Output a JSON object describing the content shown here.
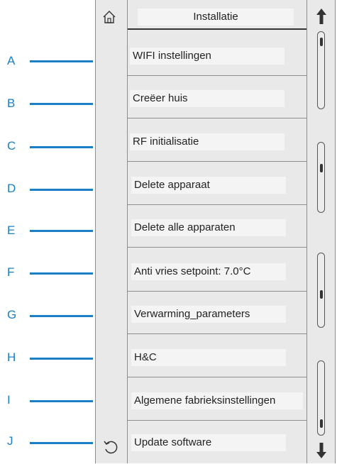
{
  "header": {
    "title": "Installatie"
  },
  "callouts": [
    "A",
    "B",
    "C",
    "D",
    "E",
    "F",
    "G",
    "H",
    "I",
    "J"
  ],
  "menu": {
    "items": [
      {
        "label": "WIFI instellingen"
      },
      {
        "label": "Creëer huis"
      },
      {
        "label": "RF initialisatie"
      },
      {
        "label": "Delete apparaat"
      },
      {
        "label": "Delete alle apparaten"
      },
      {
        "label": "Anti vries setpoint: 7.0°C"
      },
      {
        "label": "Verwarming_parameters"
      },
      {
        "label": "H&C"
      },
      {
        "label": "Algemene fabrieksinstellingen"
      },
      {
        "label": "Update software"
      }
    ]
  },
  "icons": {
    "home": "home-icon",
    "back": "undo-icon",
    "scroll_up": "arrow-up-icon",
    "scroll_down": "arrow-down-icon"
  },
  "colors": {
    "callout": "#1a7fc4"
  }
}
